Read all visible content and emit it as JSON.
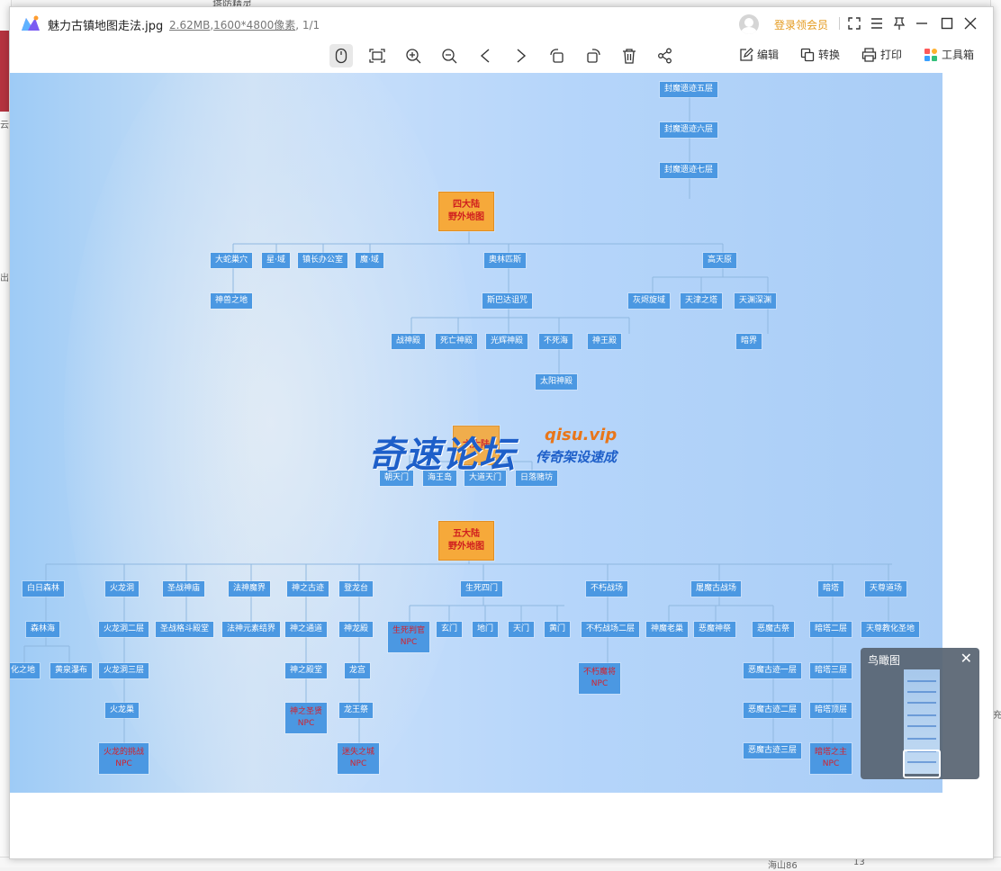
{
  "viewer": {
    "title": "魅力古镇地图走法.jpg",
    "file_size": "2.62MB",
    "dimensions": "1600*4800像素",
    "page_count": "1/1",
    "vip_label": "登录领会员"
  },
  "toolbar": {
    "edit": "编辑",
    "convert": "转换",
    "print": "打印",
    "toolbox": "工具箱"
  },
  "birdseye": {
    "title": "鸟瞰图"
  },
  "background": {
    "frag_top": "塔防精灵",
    "frag_left_1": "云",
    "frag_left_2": "出",
    "frag_bottom_1": "海山86",
    "frag_bottom_2": "13",
    "frag_right": "充"
  },
  "watermark": {
    "main": "奇速论坛",
    "url": "qisu.vip",
    "sub": "传奇架设速成",
    "hidden_label": "六大陆"
  },
  "map": {
    "roots": {
      "r4_line1": "四大陆",
      "r4_line2": "野外地图",
      "r5_line1": "五大陆",
      "r5_line2": "野外地图"
    },
    "nodes": {
      "fmy5": "封魔遗迹五层",
      "fmy6": "封魔遗迹六层",
      "fmy7": "封魔遗迹七层",
      "dsk": "大蛇巢穴",
      "xy": "星·域",
      "zz": "镇长办公室",
      "my": "魔·域",
      "olps": "奥林匹斯",
      "gtq": "高天原",
      "sszd": "神兽之地",
      "sbd": "斯巴达诅咒",
      "hhxw": "灰烬旋域",
      "tjzt": "天津之塔",
      "tyse": "天渊深渊",
      "zsd": "战神殿",
      "swsd": "死亡神殿",
      "ghsd": "光辉神殿",
      "bsh": "不死海",
      "swd": "神王殿",
      "mj": "暗界",
      "tysd": "太阳神殿",
      "cm": "朝天门",
      "hwd": "海王岛",
      "dtm": "大道天门",
      "rlfd": "日落赌坊",
      "brsl": "白日森林",
      "hld": "火龙洞",
      "szsd": "圣战神庙",
      "fsmj": "法神魔界",
      "szgj": "神之古迹",
      "dlt": "登龙台",
      "sssm": "生死四门",
      "bxzc": "不朽战场",
      "tmgzc": "屠魔古战场",
      "at": "暗塔",
      "tzdc": "天尊道场",
      "slh": "森林海",
      "hld2": "火龙洞二层",
      "szgd": "圣战格斗殿堂",
      "fsys": "法神元素结界",
      "szty": "神之通道",
      "slsd": "神龙殿",
      "sm1": "玄门",
      "sm2": "地门",
      "sm3": "天门",
      "sm4": "黄门",
      "bxzc2": "不朽战场二层",
      "smlc": "神魔老巢",
      "emsj": "恶魔神祭",
      "emgj": "恶魔古祭",
      "at2": "暗塔二层",
      "tzsd": "天尊教化圣地",
      "hzd": "化之地",
      "hqpb": "黄泉瀑布",
      "hld3": "火龙洞三层",
      "szdt": "神之殿堂",
      "lg": "龙宫",
      "emgj1": "恶魔古迹一层",
      "at3": "暗塔三层",
      "hlcs": "火龙巢",
      "lwj": "龙王祭",
      "emgj2": "恶魔古迹二层",
      "atdc": "暗塔顶层",
      "emgj3": "恶魔古迹三层"
    },
    "npcs": {
      "shdp": "生死判官",
      "bxmj": "不朽魔将",
      "szzz": "神之圣贤",
      "hldz": "火龙的挑战",
      "mwzs": "迷失之城",
      "atzz": "暗塔之主",
      "npc": "NPC"
    }
  }
}
